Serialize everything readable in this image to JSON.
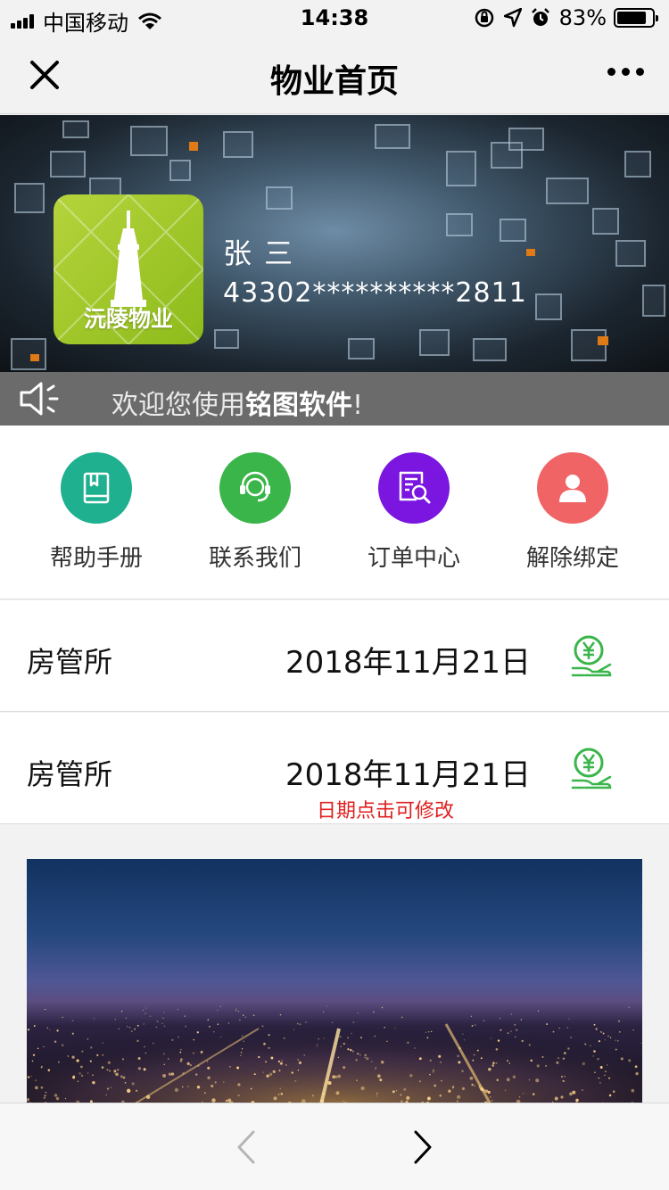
{
  "status_bar": {
    "carrier": "中国移动",
    "time": "14:38",
    "battery": "83%",
    "battery_level": 0.83,
    "icons": [
      "signal-icon",
      "wifi-icon",
      "rotation-lock-icon",
      "location-icon",
      "alarm-icon",
      "battery-icon"
    ]
  },
  "nav": {
    "title": "物业首页",
    "close_icon": "close-icon",
    "more_icon": "more-icon"
  },
  "profile": {
    "logo_text": "沅陵物业",
    "name": "张 三",
    "id_number": "43302**********2811"
  },
  "notice": {
    "icon": "speaker-icon",
    "prefix": "欢迎您使用",
    "brand": "铭图软件",
    "suffix": "!"
  },
  "actions": [
    {
      "label": "帮助手册",
      "icon": "book-icon",
      "color": "#1fb08f"
    },
    {
      "label": "联系我们",
      "icon": "headset-icon",
      "color": "#3ab54a"
    },
    {
      "label": "订单中心",
      "icon": "order-search-icon",
      "color": "#7a16e0"
    },
    {
      "label": "解除绑定",
      "icon": "user-icon",
      "color": "#f06466"
    }
  ],
  "records": [
    {
      "name": "房管所",
      "date": "2018年11月21日",
      "icon": "payment-icon",
      "hint": ""
    },
    {
      "name": "房管所",
      "date": "2018年11月21日",
      "icon": "payment-icon",
      "hint": "日期点击可修改"
    }
  ],
  "colors": {
    "accent_green": "#3ab54a",
    "hint_red": "#e02020"
  },
  "toolbar": {
    "back_icon": "chevron-left-icon",
    "forward_icon": "chevron-right-icon"
  }
}
